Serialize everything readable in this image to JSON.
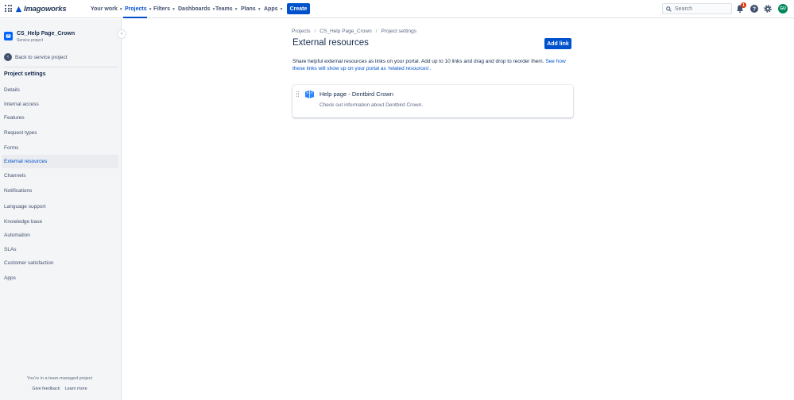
{
  "topnav": {
    "brand": "Imagoworks",
    "items": [
      {
        "label": "Your work",
        "active": false
      },
      {
        "label": "Projects",
        "active": true
      },
      {
        "label": "Filters",
        "active": false
      },
      {
        "label": "Dashboards",
        "active": false
      },
      {
        "label": "Teams",
        "active": false
      },
      {
        "label": "Plans",
        "active": false
      },
      {
        "label": "Apps",
        "active": false
      }
    ],
    "create_label": "Create",
    "search_placeholder": "Search",
    "notification_count": "1",
    "avatar_initials": "GU",
    "accent_color": "#0052cc"
  },
  "sidebar": {
    "project_name": "CS_Help Page_Crown",
    "project_type": "Service project",
    "back_label": "Back to service project",
    "section_title": "Project settings",
    "items": [
      {
        "label": "Details",
        "selected": false
      },
      {
        "label": "Internal access",
        "selected": false
      },
      {
        "label": "Features",
        "selected": false
      },
      {
        "label": "Request types",
        "selected": false
      },
      {
        "label": "Forms",
        "selected": false
      },
      {
        "label": "External resources",
        "selected": true
      },
      {
        "label": "Channels",
        "selected": false
      },
      {
        "label": "Notifications",
        "selected": false
      },
      {
        "label": "Language support",
        "selected": false
      },
      {
        "label": "Knowledge base",
        "selected": false
      },
      {
        "label": "Automation",
        "selected": false
      },
      {
        "label": "SLAs",
        "selected": false
      },
      {
        "label": "Customer satisfaction",
        "selected": false
      },
      {
        "label": "Apps",
        "selected": false
      }
    ],
    "footer_text": "You're in a team-managed project",
    "feedback_label": "Give feedback",
    "learn_more_label": "Learn more"
  },
  "main": {
    "breadcrumbs": [
      "Projects",
      "CS_Help Page_Crown",
      "Project settings"
    ],
    "title": "External resources",
    "add_link_label": "Add link",
    "description": "Share helpful external resources as links on your portal. Add up to 10 links and drag and drop to reorder them.",
    "description_link": "See how these links will show up on your portal as 'related resources'.",
    "resources": [
      {
        "title": "Help page - Dentbird Crown",
        "description": "Check out information about Dentbird Crown."
      }
    ]
  }
}
